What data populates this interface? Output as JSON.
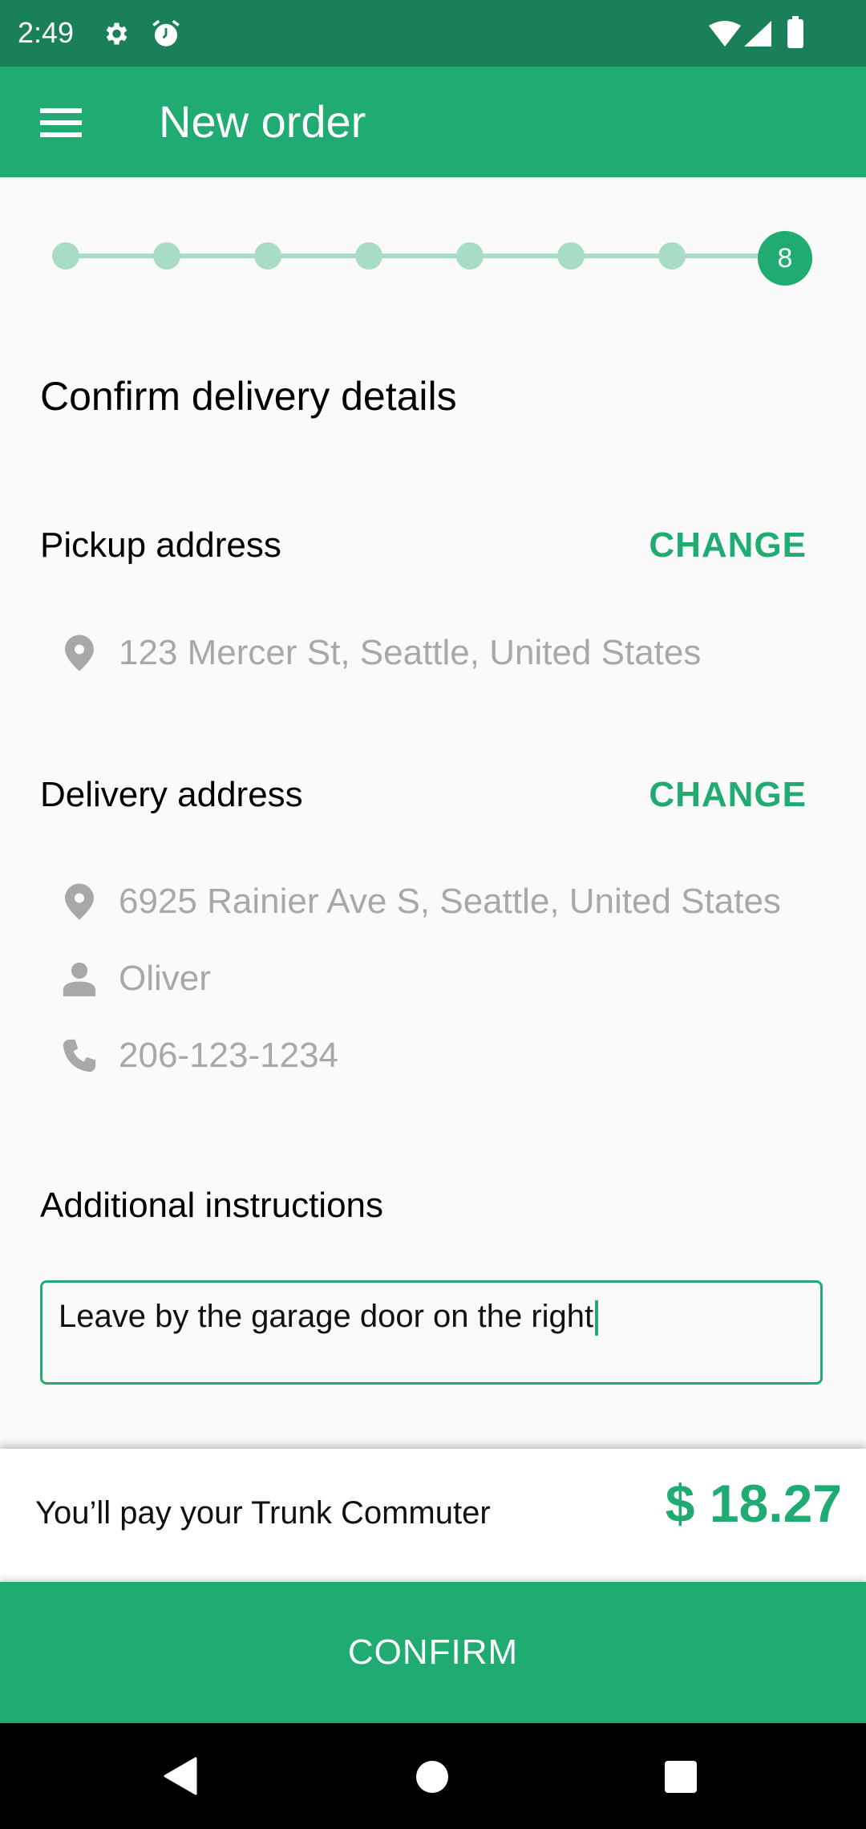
{
  "status_bar": {
    "time": "2:49",
    "icons": [
      "gear-icon",
      "alarm-icon",
      "wifi-icon",
      "signal-icon",
      "battery-icon"
    ]
  },
  "app_bar": {
    "title": "New order",
    "menu_icon": "menu-icon"
  },
  "stepper": {
    "total_steps": 8,
    "current_step": 8,
    "current_label": "8",
    "colors": {
      "completed": "#a8dcc5",
      "active": "#1fab71"
    }
  },
  "page": {
    "heading": "Confirm delivery details"
  },
  "pickup": {
    "title": "Pickup address",
    "change_label": "CHANGE",
    "address": "123 Mercer St, Seattle, United States"
  },
  "delivery": {
    "title": "Delivery address",
    "change_label": "CHANGE",
    "address": "6925 Rainier Ave S, Seattle, United States",
    "name": "Oliver",
    "phone": "206-123-1234"
  },
  "instructions": {
    "title": "Additional instructions",
    "value": "Leave by the garage door on the right"
  },
  "payment": {
    "label": "You’ll pay your Trunk Commuter",
    "amount": "$ 18.27"
  },
  "confirm_button": {
    "label": "CONFIRM"
  },
  "nav_bar": {
    "buttons": [
      "back-icon",
      "home-icon",
      "recents-icon"
    ]
  },
  "colors": {
    "primary": "#1fab71",
    "primary_dark": "#19805a",
    "secondary_text": "#a8a8a8"
  }
}
